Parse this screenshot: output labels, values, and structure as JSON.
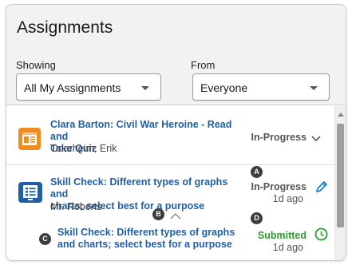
{
  "header": {
    "title": "Assignments",
    "showing_label": "Showing",
    "showing_value": "All My Assignments",
    "from_label": "From",
    "from_value": "Everyone"
  },
  "assignments": [
    {
      "title_line1": "Clara Barton: Civil War Heroine - Read and",
      "title_line2": "Take Quiz",
      "author": "Onarheim, Erik",
      "status": "In-Progress",
      "icon": "document-icon"
    },
    {
      "title_line1": "Skill Check: Different types of graphs and",
      "title_line2": "charts; select best for a purpose",
      "author": "Mr. Roberts",
      "status": "In-Progress",
      "time": "1d ago",
      "icon": "checklist-icon",
      "action_icon": "pencil-icon",
      "sub_item": {
        "title_line1": "Skill Check: Different types of graphs",
        "title_line2": "and charts; select best for a purpose",
        "status": "Submitted",
        "time": "1d ago",
        "action_icon": "clock-icon"
      }
    }
  ],
  "markers": {
    "a": "A",
    "b": "B",
    "c": "C",
    "d": "D"
  },
  "colors": {
    "link": "#1f5fa8",
    "submitted": "#2e9a2e",
    "doc_icon_bg": "#f08c1e",
    "check_icon_bg": "#1f5fa8"
  }
}
